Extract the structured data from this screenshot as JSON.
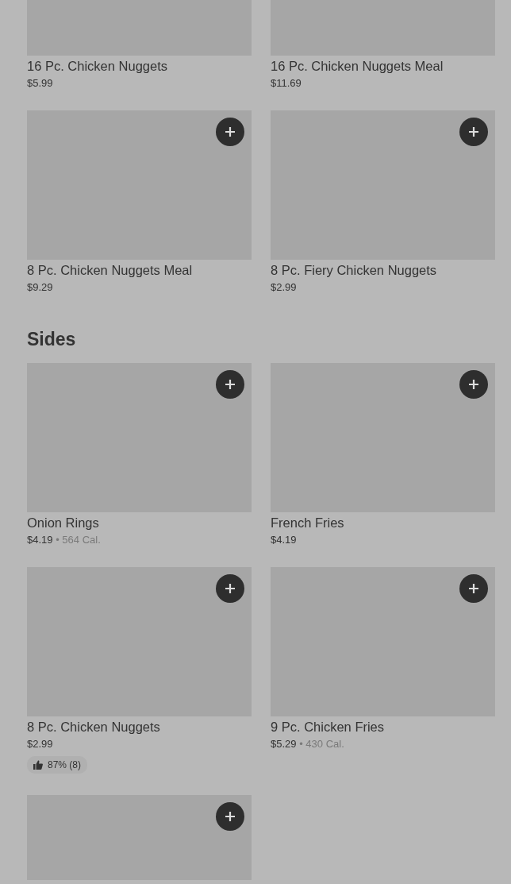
{
  "sections": [
    {
      "items": [
        {
          "kind": "top_cut",
          "name": "16 Pc. Chicken Nuggets",
          "price": "$5.99"
        },
        {
          "kind": "top_cut",
          "name": "16 Pc. Chicken Nuggets Meal",
          "price": "$11.69"
        },
        {
          "kind": "item",
          "name": "8 Pc. Chicken Nuggets Meal",
          "price": "$9.29"
        },
        {
          "kind": "item",
          "name": "8 Pc. Fiery Chicken Nuggets",
          "price": "$2.99"
        }
      ]
    },
    {
      "title": "Sides",
      "items": [
        {
          "kind": "item",
          "name": "Onion Rings",
          "price": "$4.19",
          "separator": "•",
          "calories": "564 Cal."
        },
        {
          "kind": "item",
          "name": "French Fries",
          "price": "$4.19"
        },
        {
          "kind": "item",
          "name": "8 Pc. Chicken Nuggets",
          "price": "$2.99",
          "rating": "87% (8)"
        },
        {
          "kind": "item",
          "name": "9 Pc. Chicken Fries",
          "price": "$5.29",
          "separator": "•",
          "calories": "430 Cal."
        },
        {
          "kind": "bottom_cut"
        }
      ]
    }
  ]
}
